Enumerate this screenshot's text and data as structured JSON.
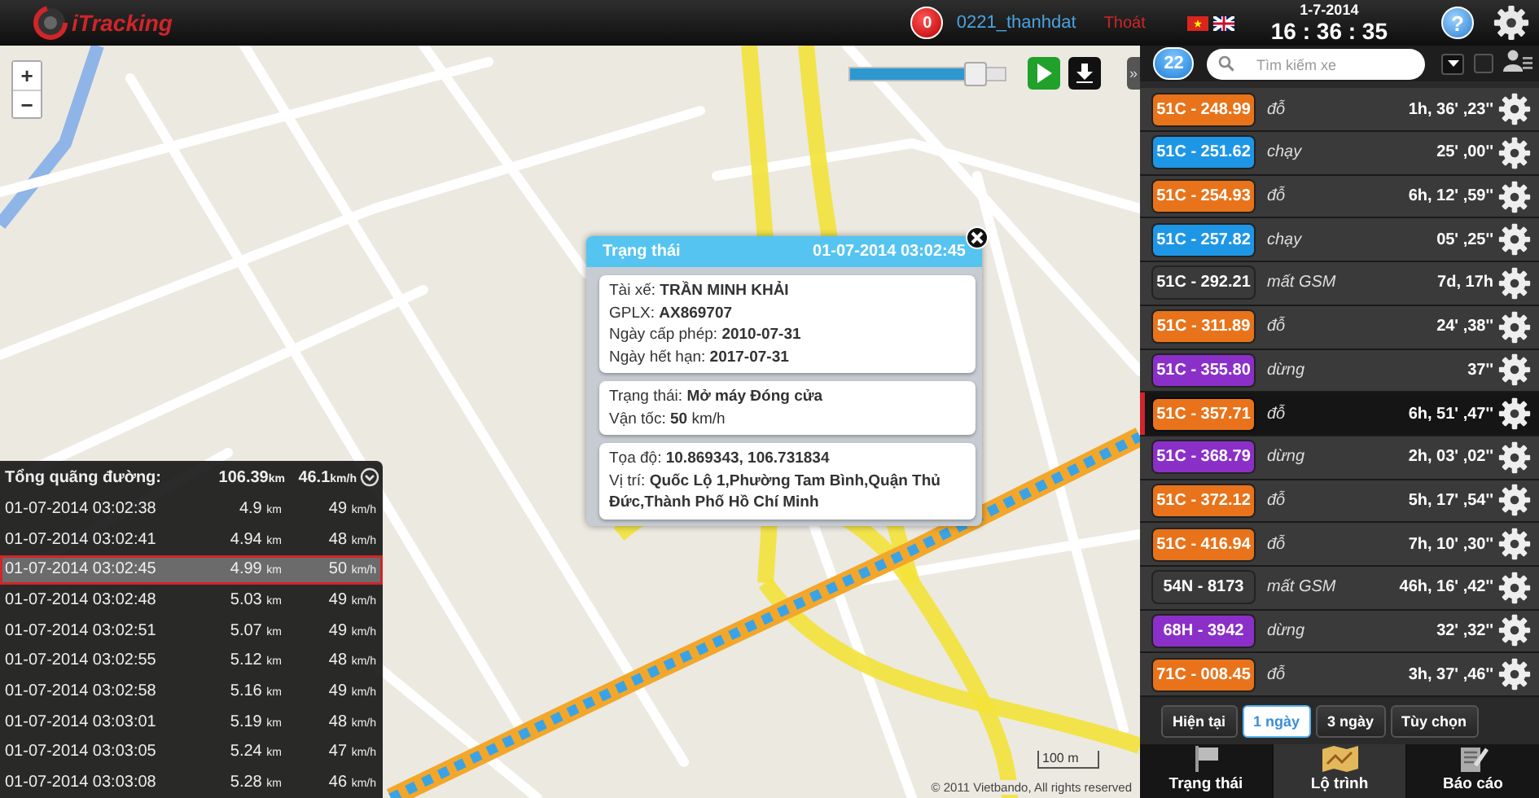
{
  "header": {
    "logo": "iTracking",
    "alert_count": "0",
    "username": "0221_thanhdat",
    "logout": "Thoát",
    "date": "1-7-2014",
    "time": "16 : 36 : 35",
    "help": "?"
  },
  "map": {
    "zoom_in": "+",
    "zoom_out": "−",
    "playback": {
      "level": 0.8
    },
    "collapse": "»",
    "scale": "100 m",
    "copyright": "© 2011 Vietbando, All rights reserved"
  },
  "popup": {
    "title": "Trạng thái",
    "timestamp": "01-07-2014 03:02:45",
    "sections": [
      [
        "Tài xế: **TRẦN MINH KHẢI**",
        "GPLX: **AX869707**",
        "Ngày cấp phép: **2010-07-31**",
        "Ngày hết hạn: **2017-07-31**"
      ],
      [
        "Trạng thái: **Mở máy Đóng cửa**",
        "Vận tốc: **50** km/h"
      ],
      [
        "Tọa độ: **10.869343, 106.731834**",
        "Vị trí: **Quốc Lộ 1,Phường Tam Bình,Quận Thủ Đức,Thành Phố Hồ Chí Minh**"
      ]
    ]
  },
  "trip": {
    "summary": {
      "label": "Tổng quãng đường:",
      "distance": "106.39",
      "distance_unit": "km",
      "speed": "46.1",
      "speed_unit": "km/h"
    },
    "rows": [
      {
        "time": "01-07-2014 03:02:38",
        "distance": "4.9",
        "distance_unit": "km",
        "speed": "49",
        "speed_unit": "km/h",
        "selected": false
      },
      {
        "time": "01-07-2014 03:02:41",
        "distance": "4.94",
        "distance_unit": "km",
        "speed": "48",
        "speed_unit": "km/h",
        "selected": false
      },
      {
        "time": "01-07-2014 03:02:45",
        "distance": "4.99",
        "distance_unit": "km",
        "speed": "50",
        "speed_unit": "km/h",
        "selected": true
      },
      {
        "time": "01-07-2014 03:02:48",
        "distance": "5.03",
        "distance_unit": "km",
        "speed": "49",
        "speed_unit": "km/h",
        "selected": false
      },
      {
        "time": "01-07-2014 03:02:51",
        "distance": "5.07",
        "distance_unit": "km",
        "speed": "49",
        "speed_unit": "km/h",
        "selected": false
      },
      {
        "time": "01-07-2014 03:02:55",
        "distance": "5.12",
        "distance_unit": "km",
        "speed": "48",
        "speed_unit": "km/h",
        "selected": false
      },
      {
        "time": "01-07-2014 03:02:58",
        "distance": "5.16",
        "distance_unit": "km",
        "speed": "49",
        "speed_unit": "km/h",
        "selected": false
      },
      {
        "time": "01-07-2014 03:03:01",
        "distance": "5.19",
        "distance_unit": "km",
        "speed": "48",
        "speed_unit": "km/h",
        "selected": false
      },
      {
        "time": "01-07-2014 03:03:05",
        "distance": "5.24",
        "distance_unit": "km",
        "speed": "47",
        "speed_unit": "km/h",
        "selected": false
      },
      {
        "time": "01-07-2014 03:03:08",
        "distance": "5.28",
        "distance_unit": "km",
        "speed": "46",
        "speed_unit": "km/h",
        "selected": false
      }
    ]
  },
  "panel": {
    "count": "22",
    "search": {
      "placeholder": "Tìm kiếm xe"
    },
    "select_all": {
      "checked": false
    },
    "vehicles": [
      {
        "plate": "51C - 248.99",
        "color": "#e8731a",
        "status": "đỗ",
        "duration": "1h, 36' ,23''",
        "selected": false
      },
      {
        "plate": "51C - 251.62",
        "color": "#1e96e6",
        "status": "chạy",
        "duration": "25' ,00''",
        "selected": false
      },
      {
        "plate": "51C - 254.93",
        "color": "#e8731a",
        "status": "đỗ",
        "duration": "6h, 12' ,59''",
        "selected": false
      },
      {
        "plate": "51C - 257.82",
        "color": "#1e96e6",
        "status": "chạy",
        "duration": "05' ,25''",
        "selected": false
      },
      {
        "plate": "51C - 292.21",
        "color": "#3a3a3a",
        "status": "mất GSM",
        "duration": "7d, 17h",
        "selected": false
      },
      {
        "plate": "51C - 311.89",
        "color": "#e8731a",
        "status": "đỗ",
        "duration": "24' ,38''",
        "selected": false
      },
      {
        "plate": "51C - 355.80",
        "color": "#8b2fc9",
        "status": "dừng",
        "duration": "37''",
        "selected": false
      },
      {
        "plate": "51C - 357.71",
        "color": "#e8731a",
        "status": "đỗ",
        "duration": "6h, 51' ,47''",
        "selected": true
      },
      {
        "plate": "51C - 368.79",
        "color": "#8b2fc9",
        "status": "dừng",
        "duration": "2h, 03' ,02''",
        "selected": false
      },
      {
        "plate": "51C - 372.12",
        "color": "#e8731a",
        "status": "đỗ",
        "duration": "5h, 17' ,54''",
        "selected": false
      },
      {
        "plate": "51C - 416.94",
        "color": "#e8731a",
        "status": "đỗ",
        "duration": "7h, 10' ,30''",
        "selected": false
      },
      {
        "plate": "54N - 8173",
        "color": "#3a3a3a",
        "status": "mất GSM",
        "duration": "46h, 16' ,42''",
        "selected": false
      },
      {
        "plate": "68H - 3942",
        "color": "#8b2fc9",
        "status": "dừng",
        "duration": "32' ,32''",
        "selected": false
      },
      {
        "plate": "71C - 008.45",
        "color": "#e8731a",
        "status": "đỗ",
        "duration": "3h, 37' ,46''",
        "selected": false
      }
    ],
    "time_filters": [
      {
        "label": "Hiện tại",
        "selected": false
      },
      {
        "label": "1 ngày",
        "selected": true
      },
      {
        "label": "3 ngày",
        "selected": false
      },
      {
        "label": "Tùy chọn",
        "selected": false
      }
    ],
    "tabs": [
      {
        "label": "Trạng thái",
        "selected": false
      },
      {
        "label": "Lộ trình",
        "selected": true
      },
      {
        "label": "Báo cáo",
        "selected": false
      }
    ]
  }
}
